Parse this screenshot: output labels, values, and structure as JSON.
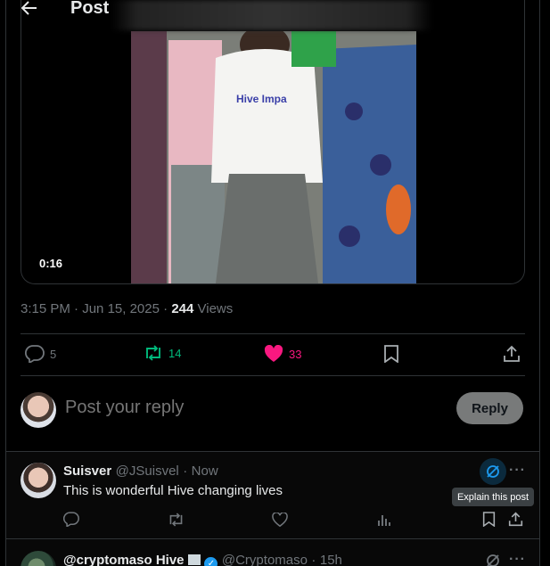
{
  "header": {
    "title": "Post"
  },
  "media": {
    "duration": "0:16"
  },
  "meta": {
    "time": "3:15 PM",
    "date": "Jun 15, 2025",
    "views_count": "244",
    "views_label": "Views",
    "sep1": " · ",
    "sep2": " · "
  },
  "actions": {
    "replies": "5",
    "reposts": "14",
    "likes": "33"
  },
  "composer": {
    "placeholder": "Post your reply",
    "reply_label": "Reply"
  },
  "reply1": {
    "name": "Suisver",
    "handle": "@JSuisvel",
    "sep": "·",
    "time": "Now",
    "text": "This is wonderful Hive changing lives",
    "tooltip": "Explain this post",
    "more": "···"
  },
  "reply2": {
    "name": "@cryptomaso Hive",
    "handle": "@Cryptomaso",
    "sep": "·",
    "time": "15h",
    "more": "···"
  },
  "colors": {
    "repost": "#00ba7c",
    "like": "#f91880",
    "grok": "#1d9bf0",
    "muted": "#71767b"
  },
  "icons": [
    "back-arrow-icon",
    "reply-icon",
    "repost-icon",
    "heart-icon",
    "bookmark-icon",
    "share-icon",
    "grok-icon",
    "more-icon",
    "analytics-icon",
    "verified-icon"
  ]
}
